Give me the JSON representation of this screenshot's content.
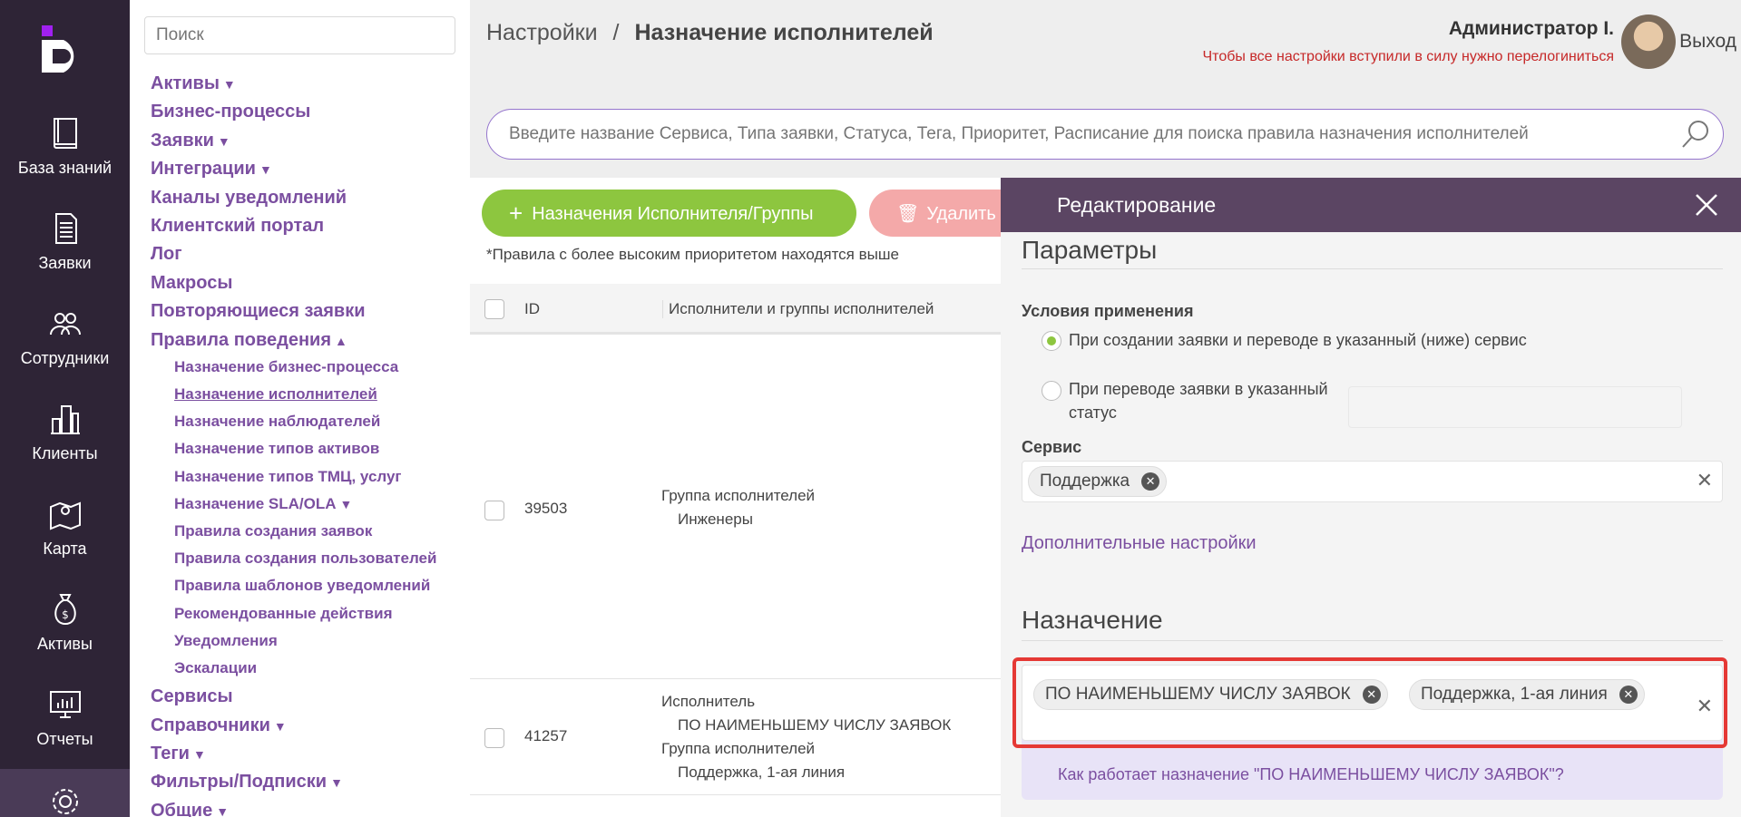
{
  "rail": {
    "items": [
      {
        "label": "База знаний",
        "icon": "book-icon"
      },
      {
        "label": "Заявки",
        "icon": "document-icon"
      },
      {
        "label": "Сотрудники",
        "icon": "people-icon"
      },
      {
        "label": "Клиенты",
        "icon": "buildings-icon"
      },
      {
        "label": "Карта",
        "icon": "map-icon"
      },
      {
        "label": "Активы",
        "icon": "money-bag-icon"
      },
      {
        "label": "Отчеты",
        "icon": "chart-monitor-icon"
      }
    ]
  },
  "nav": {
    "search_placeholder": "Поиск",
    "items": [
      {
        "label": "Активы",
        "caret": "▼"
      },
      {
        "label": "Бизнес-процессы",
        "caret": ""
      },
      {
        "label": "Заявки",
        "caret": "▼"
      },
      {
        "label": "Интеграции",
        "caret": "▼"
      },
      {
        "label": "Каналы уведомлений",
        "caret": ""
      },
      {
        "label": "Клиентский портал",
        "caret": ""
      },
      {
        "label": "Лог",
        "caret": ""
      },
      {
        "label": "Макросы",
        "caret": ""
      },
      {
        "label": "Повторяющиеся заявки",
        "caret": ""
      },
      {
        "label": "Правила поведения",
        "caret": "▲"
      }
    ],
    "sub_items": [
      {
        "label": "Назначение бизнес-процесса",
        "caret": ""
      },
      {
        "label": "Назначение исполнителей",
        "caret": ""
      },
      {
        "label": "Назначение наблюдателей",
        "caret": ""
      },
      {
        "label": "Назначение типов активов",
        "caret": ""
      },
      {
        "label": "Назначение типов ТМЦ, услуг",
        "caret": ""
      },
      {
        "label": "Назначение SLA/OLA",
        "caret": "▼"
      },
      {
        "label": "Правила создания заявок",
        "caret": ""
      },
      {
        "label": "Правила создания пользователей",
        "caret": ""
      },
      {
        "label": "Правила шаблонов уведомлений",
        "caret": ""
      },
      {
        "label": "Рекомендованные действия",
        "caret": ""
      },
      {
        "label": "Уведомления",
        "caret": ""
      },
      {
        "label": "Эскалации",
        "caret": ""
      }
    ],
    "items_after": [
      {
        "label": "Сервисы",
        "caret": ""
      },
      {
        "label": "Справочники",
        "caret": "▼"
      },
      {
        "label": "Теги",
        "caret": "▼"
      },
      {
        "label": "Фильтры/Подписки",
        "caret": "▼"
      },
      {
        "label": "Общие",
        "caret": "▼"
      }
    ]
  },
  "header": {
    "crumb_root": "Настройки",
    "crumb_sep": "/",
    "crumb_current": "Назначение исполнителей",
    "user_name": "Администратор I.",
    "user_note": "Чтобы все настройки вступили в силу нужно перелогиниться",
    "logout": "Выход"
  },
  "search": {
    "placeholder": "Введите название Сервиса, Типа заявки, Статуса, Тега, Приоритет, Расписание для поиска правила назначения исполнителей"
  },
  "toolbar": {
    "add_label": "Назначения Исполнителя/Группы",
    "add_icon": "+",
    "delete_label": "Удалить",
    "note": "*Правила с более высоким приоритетом находятся выше"
  },
  "table": {
    "col_id": "ID",
    "col_executors": "Исполнители и группы исполнителей",
    "rows": [
      {
        "id": "39503",
        "line1": "Группа исполнителей",
        "line2": "Инженеры"
      },
      {
        "id": "41257",
        "line1": "Исполнитель",
        "line2": "ПО НАИМЕНЬШЕМУ ЧИСЛУ ЗАЯВОК",
        "line3": "Группа исполнителей",
        "line4": "Поддержка, 1-ая линия"
      }
    ]
  },
  "panel": {
    "title": "Редактирование",
    "params_title": "Параметры",
    "conditions_label": "Условия применения",
    "radio1": "При создании заявки и переводе в указанный (ниже) сервис",
    "radio2_line1": "При переводе заявки в указанный",
    "radio2_line2": "статус",
    "service_label": "Сервис",
    "service_tag": "Поддержка",
    "advanced_link": "Дополнительные настройки",
    "assign_title": "Назначение",
    "assign_tag1": "ПО НАИМЕНЬШЕМУ ЧИСЛУ ЗАЯВОК",
    "assign_tag2": "Поддержка, 1-ая линия",
    "help_link": "Как работает назначение \"ПО НАИМЕНЬШЕМУ ЧИСЛУ ЗАЯВОК\"?"
  },
  "colors": {
    "rail_bg": "#2e2436",
    "accent_purple": "#7b4fa0",
    "add_green": "#8dc63f",
    "delete_pink": "#f4a9a9",
    "panel_header": "#5b4563",
    "highlight_red": "#e53935",
    "warning_red": "#c62828"
  }
}
